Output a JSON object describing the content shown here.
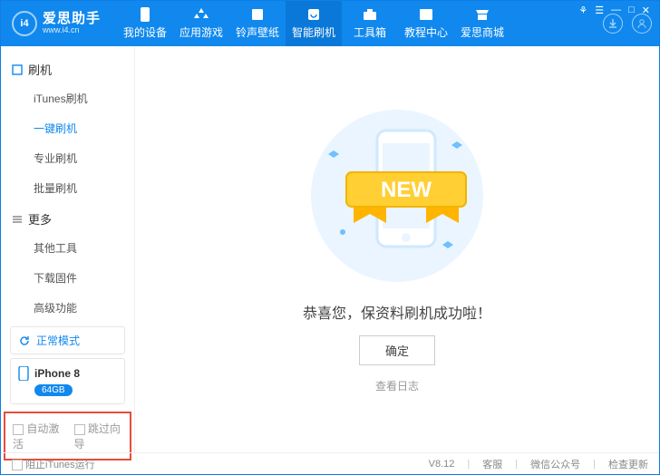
{
  "brand": {
    "title": "爱思助手",
    "sub": "www.i4.cn",
    "logo": "i4"
  },
  "tabs": [
    {
      "label": "我的设备",
      "icon": "phone-icon"
    },
    {
      "label": "应用游戏",
      "icon": "apps-icon"
    },
    {
      "label": "铃声壁纸",
      "icon": "note-icon"
    },
    {
      "label": "智能刷机",
      "icon": "refresh-icon",
      "active": true
    },
    {
      "label": "工具箱",
      "icon": "toolbox-icon"
    },
    {
      "label": "教程中心",
      "icon": "book-icon"
    },
    {
      "label": "爱思商城",
      "icon": "shop-icon"
    }
  ],
  "window_controls": {
    "settings": "☰",
    "gift": "⚘",
    "min": "—",
    "max": "□",
    "close": "✕"
  },
  "sidebar": {
    "group1": {
      "title": "刷机",
      "items": [
        "iTunes刷机",
        "一键刷机",
        "专业刷机",
        "批量刷机"
      ],
      "activeIndex": 1
    },
    "group2": {
      "title": "更多",
      "items": [
        "其他工具",
        "下载固件",
        "高级功能"
      ]
    },
    "mode_label": "正常模式",
    "device": {
      "name": "iPhone 8",
      "capacity": "64GB"
    },
    "checkbox1": "自动激活",
    "checkbox2": "跳过向导"
  },
  "main": {
    "congrats": "恭喜您，保资料刷机成功啦！",
    "ok": "确定",
    "view_log": "查看日志",
    "ribbon": "NEW"
  },
  "footer": {
    "block_itunes": "阻止iTunes运行",
    "version": "V8.12",
    "support": "客服",
    "wechat": "微信公众号",
    "update": "检查更新"
  }
}
